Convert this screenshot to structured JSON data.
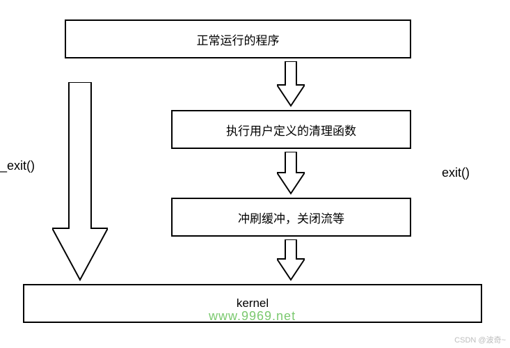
{
  "diagram": {
    "box_running": "正常运行的程序",
    "box_cleanup": "执行用户定义的清理函数",
    "box_flush": "冲刷缓冲，关闭流等",
    "box_kernel": "kernel"
  },
  "labels": {
    "exit_underscore": "_exit()",
    "exit_plain": "exit()"
  },
  "watermarks": {
    "center": "www.9969.net",
    "corner": "CSDN @波奇~"
  }
}
